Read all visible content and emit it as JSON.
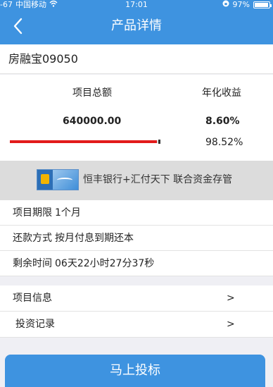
{
  "statusbar": {
    "signal": "-67",
    "carrier": "中国移动",
    "time": "17:01",
    "battery": "97%"
  },
  "navbar": {
    "title": "产品详情",
    "back_icon": "chevron-left-icon"
  },
  "product": {
    "name": "房融宝09050"
  },
  "stats": {
    "total_label": "项目总额",
    "total_value": "640000.00",
    "rate_label": "年化收益",
    "rate_value": "8.60%",
    "progress_text": "98.52%",
    "progress_fraction": 0.9852
  },
  "bank": {
    "text": "恒丰银行+汇付天下 联合资金存管"
  },
  "info": {
    "term_label": "项目期限",
    "term_value": "1个月",
    "repay_label": "还款方式",
    "repay_value": "按月付息到期还本",
    "remain_label": "剩余时间",
    "remain_value": "06天22小时27分37秒"
  },
  "links": [
    {
      "label": "项目信息",
      "arrow": ">"
    },
    {
      "label": "投资记录",
      "arrow": ">"
    }
  ],
  "cta": {
    "label": "马上投标"
  },
  "colors": {
    "primary": "#3e93e0",
    "progress": "#e21b1b"
  }
}
